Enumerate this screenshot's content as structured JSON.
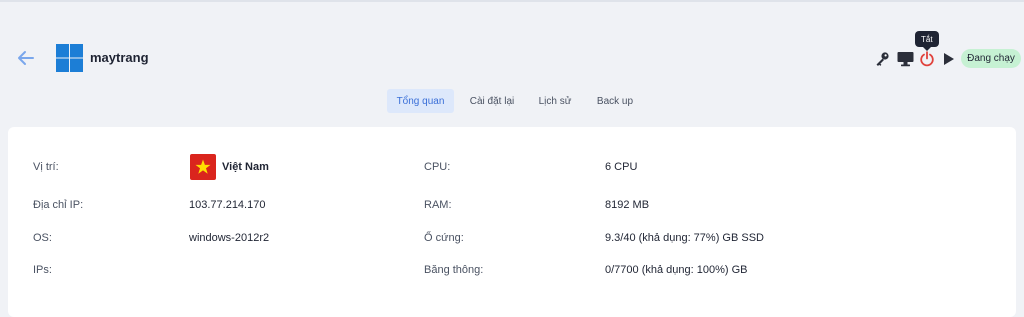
{
  "header": {
    "vm_name": "maytrang",
    "tooltip": "Tắt",
    "status": "Đang chạy",
    "icons": [
      "back-arrow-icon",
      "windows-logo-icon",
      "key-icon",
      "monitor-icon",
      "power-icon",
      "play-icon"
    ]
  },
  "tabs": [
    {
      "label": "Tổng quan",
      "active": true
    },
    {
      "label": "Cài đặt lại",
      "active": false
    },
    {
      "label": "Lịch sử",
      "active": false
    },
    {
      "label": "Back up",
      "active": false
    }
  ],
  "details": {
    "location_label": "Vị trí:",
    "location_value": "Việt Nam",
    "ip_label": "Địa chỉ IP:",
    "ip_value": "103.77.214.170",
    "os_label": "OS:",
    "os_value": "windows-2012r2",
    "ips_label": "IPs:",
    "ips_value": "",
    "cpu_label": "CPU:",
    "cpu_value": "6 CPU",
    "ram_label": "RAM:",
    "ram_value": "8192 MB",
    "disk_label": "Ổ cứng:",
    "disk_value": "9.3/40 (khả dụng: 77%) GB SSD",
    "bandwidth_label": "Băng thông:",
    "bandwidth_value": "0/7700 (khả dụng: 100%) GB"
  },
  "colors": {
    "accent": "#3a6fd8",
    "status_bg": "#c6f1d3",
    "power_red": "#e0413b",
    "flag_red": "#da251d",
    "flag_star": "#ffde00"
  }
}
